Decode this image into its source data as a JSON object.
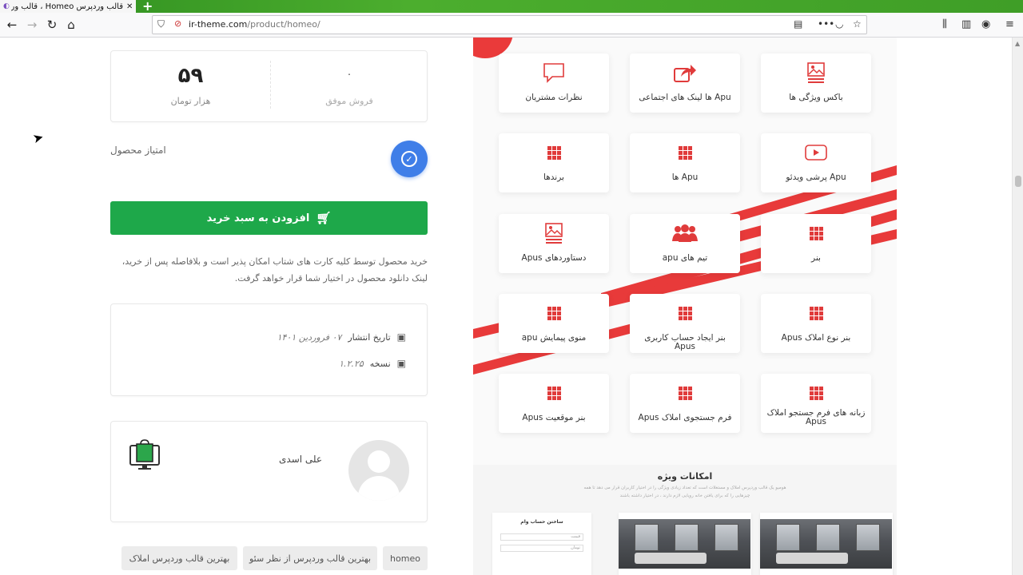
{
  "browser": {
    "tab_title": "قالب وردپرس Homeo ، قالب وردپرس",
    "url_host": "ir-theme.com",
    "url_path": "/product/homeo/"
  },
  "stats": {
    "price_value": "۵۹",
    "price_label": "هزار تومان",
    "sales_value": "۰",
    "sales_label": "فروش موفق"
  },
  "rating": {
    "label": "امتیاز محصول"
  },
  "cart": {
    "button_label": "افزودن به سبد خرید"
  },
  "purchase_note": "خرید محصول توسط کلیه کارت های شتاب امکان پذیر است و بلافاصله پس از خرید، لینک دانلود محصول در اختیار شما قرار خواهد گرفت.",
  "meta": {
    "release_label": "تاریخ انتشار",
    "release_value": "۰۷ فروردین ۱۴۰۱",
    "version_label": "نسخه",
    "version_value": "۱.۲.۲۵"
  },
  "author": {
    "name": "علی اسدی"
  },
  "tags": [
    "homeo",
    "بهترین قالب وردپرس از نظر سئو",
    "بهترین قالب وردپرس املاک"
  ],
  "features": [
    {
      "label": "باکس ویژگی ها",
      "icon": "image-icon"
    },
    {
      "label": "Apu ها لینک های اجتماعی",
      "icon": "share-icon"
    },
    {
      "label": "نظرات مشتریان",
      "icon": "comment-icon"
    },
    {
      "label": "Apu پرشی ویدئو",
      "icon": "video-icon"
    },
    {
      "label": "Apu ها",
      "icon": "grid-icon"
    },
    {
      "label": "برندها",
      "icon": "grid-icon"
    },
    {
      "label": "بنر",
      "icon": "grid-icon"
    },
    {
      "label": "تیم های apu",
      "icon": "team-icon"
    },
    {
      "label": "دستاوردهای Apus",
      "icon": "image-icon"
    },
    {
      "label": "بنر نوع املاک Apus",
      "icon": "grid-icon"
    },
    {
      "label": "بنر ایجاد حساب کاربری Apus",
      "icon": "grid-icon"
    },
    {
      "label": "منوی پیمایش apu",
      "icon": "grid-icon"
    },
    {
      "label": "زبانه های فرم جستجو املاک Apus",
      "icon": "grid-icon"
    },
    {
      "label": "فرم جستجوی املاک Apus",
      "icon": "grid-icon"
    },
    {
      "label": "بنر موقعیت Apus",
      "icon": "grid-icon"
    }
  ],
  "special": {
    "title": "امکانات ویژه",
    "subtitle": "هومیو یک قالب وردپرس املاک و مستغلات است که تعداد زیادی ویژگی را در اختیار کاربران قرار می دهد تا همه چیزهایی را که برای یافتن خانه رویایی لازم دارند ، در اختیار داشته باشند",
    "form_title": "ساختن حساب وام",
    "form_field_1": "قیمت",
    "form_field_2": "تومان"
  },
  "colors": {
    "accent_red": "#e03b3b",
    "cart_green": "#1ea84a",
    "check_blue": "#3f7ee8"
  }
}
